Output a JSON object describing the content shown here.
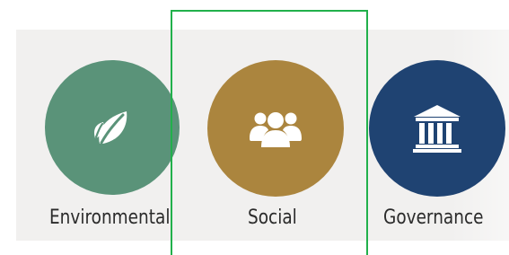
{
  "categories": [
    {
      "key": "environmental",
      "label": "Environmental",
      "icon": "leaf-icon",
      "color": "#5a9379"
    },
    {
      "key": "social",
      "label": "Social",
      "icon": "people-icon",
      "color": "#ab853e"
    },
    {
      "key": "governance",
      "label": "Governance",
      "icon": "building-columns-icon",
      "color": "#1f4372"
    }
  ],
  "selection": {
    "selected": "social",
    "color": "#21b04b"
  },
  "background_band_color": "#f1f0ef"
}
